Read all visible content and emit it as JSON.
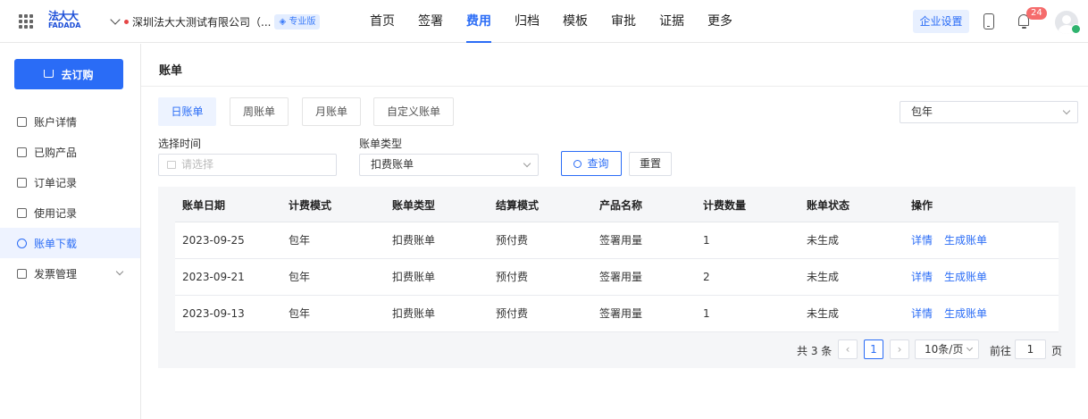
{
  "header": {
    "logo_line1": "法大大",
    "logo_line2": "FADADA",
    "company_name": "深圳法大大测试有限公司（...",
    "edition_badge": "专业版",
    "nav": [
      "首页",
      "签署",
      "费用",
      "归档",
      "模板",
      "审批",
      "证据",
      "更多"
    ],
    "nav_active": "费用",
    "enterprise_settings": "企业设置",
    "notification_count": "24"
  },
  "sidebar": {
    "order_button": "去订购",
    "items": [
      {
        "label": "账户详情",
        "icon": "user-icon"
      },
      {
        "label": "已购产品",
        "icon": "bar-chart-icon"
      },
      {
        "label": "订单记录",
        "icon": "order-icon"
      },
      {
        "label": "使用记录",
        "icon": "clipboard-icon"
      },
      {
        "label": "账单下载",
        "icon": "coin-icon",
        "active": true
      },
      {
        "label": "发票管理",
        "icon": "invoice-icon",
        "expandable": true
      }
    ]
  },
  "main": {
    "title": "账单",
    "tabs": [
      "日账单",
      "周账单",
      "月账单",
      "自定义账单"
    ],
    "active_tab": "日账单",
    "plan_select": "包年",
    "filters": {
      "time_label": "选择时间",
      "time_placeholder": "请选择",
      "type_label": "账单类型",
      "type_value": "扣费账单",
      "query_button": "查询",
      "reset_button": "重置"
    },
    "table": {
      "columns": [
        "账单日期",
        "计费模式",
        "账单类型",
        "结算模式",
        "产品名称",
        "计费数量",
        "账单状态",
        "操作"
      ],
      "rows": [
        [
          "2023-09-25",
          "包年",
          "扣费账单",
          "预付费",
          "签署用量",
          "1",
          "未生成"
        ],
        [
          "2023-09-21",
          "包年",
          "扣费账单",
          "预付费",
          "签署用量",
          "2",
          "未生成"
        ],
        [
          "2023-09-13",
          "包年",
          "扣费账单",
          "预付费",
          "签署用量",
          "1",
          "未生成"
        ]
      ],
      "actions": [
        "详情",
        "生成账单"
      ]
    },
    "pagination": {
      "total": "共 3 条",
      "prev": "‹",
      "current_page": "1",
      "next": "›",
      "page_size": "10条/页",
      "goto_label": "前往",
      "goto_value": "1",
      "page_unit": "页"
    }
  },
  "colors": {
    "accent": "#2a6cf6",
    "badge": "#f56c6c",
    "active_bg": "#eef3ff"
  }
}
